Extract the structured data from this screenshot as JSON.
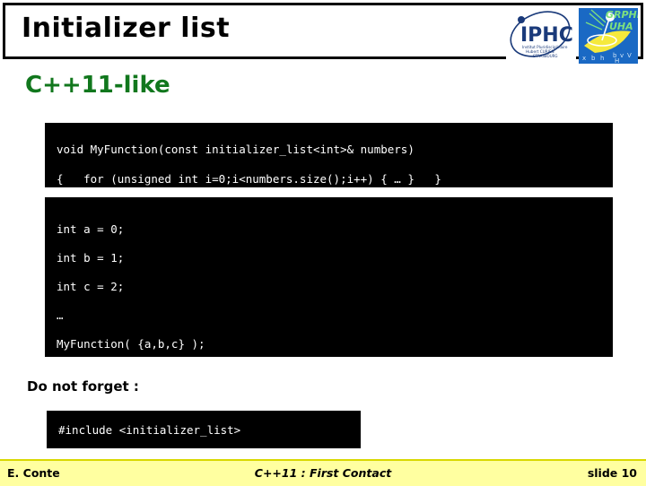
{
  "slide": {
    "title": "Initializer list",
    "section_heading": "C++11-like",
    "reminder": "Do not forget :",
    "accent_green": "#11771d",
    "footer_bg": "#ffffa0",
    "code_bg": "#000000",
    "code_fg": "#ffffff"
  },
  "logos": [
    {
      "name": "iphc-logo",
      "text": "IPHC",
      "subtitle": "Institut Pluridisciplinaire Hubert CURIEN STRASBOURG"
    },
    {
      "name": "grph-uha-logo",
      "text": "GRPHE UHA"
    }
  ],
  "code_blocks": {
    "signature": {
      "name": "function-signature-code",
      "lines": [
        "void MyFunction(const initializer_list<int>& numbers)",
        "{   for (unsigned int i=0;i<numbers.size();i++) { … }   }"
      ]
    },
    "usage": {
      "name": "usage-example-code",
      "lines": [
        "int a = 0;",
        "int b = 1;",
        "int c = 2;",
        "…",
        "MyFunction( {a,b,c} );"
      ]
    },
    "include": {
      "name": "include-directive-code",
      "lines": [
        "#include <initializer_list>"
      ]
    }
  },
  "footer": {
    "author": "E. Conte",
    "title": "C++11 : First Contact",
    "slide_number": "slide 10"
  }
}
